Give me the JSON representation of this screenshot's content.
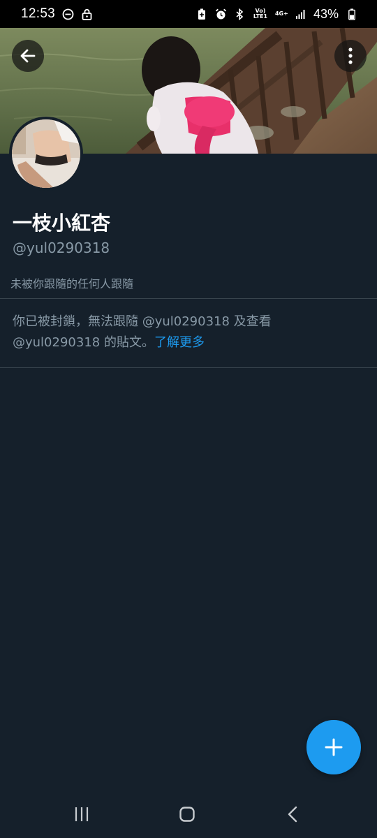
{
  "status_bar": {
    "time": "12:53",
    "signal_label": "Vo) LTE1",
    "network_label": "4G+",
    "battery_text": "43%",
    "icons": [
      "do-not-disturb-icon",
      "lock-icon",
      "battery-saver-icon",
      "alarm-icon",
      "bluetooth-icon",
      "signal-icon",
      "battery-icon"
    ]
  },
  "header": {
    "back_icon": "arrow-left-icon",
    "more_icon": "more-vertical-icon"
  },
  "profile": {
    "display_name": "一枝小紅杏",
    "handle": "@yul0290318",
    "followers_text": "未被你跟隨的任何人跟隨"
  },
  "blocked": {
    "message": "你已被封鎖，無法跟隨 @yul0290318 及查看 @yul0290318 的貼文。",
    "learn_more": "了解更多"
  },
  "fab": {
    "icon": "plus-icon"
  },
  "nav_bar": {
    "icons": [
      "recent-apps-icon",
      "home-icon",
      "back-icon"
    ]
  },
  "colors": {
    "background": "#15202b",
    "accent": "#1d9bf0",
    "secondary_text": "#8899a6",
    "divider": "#38444d"
  }
}
